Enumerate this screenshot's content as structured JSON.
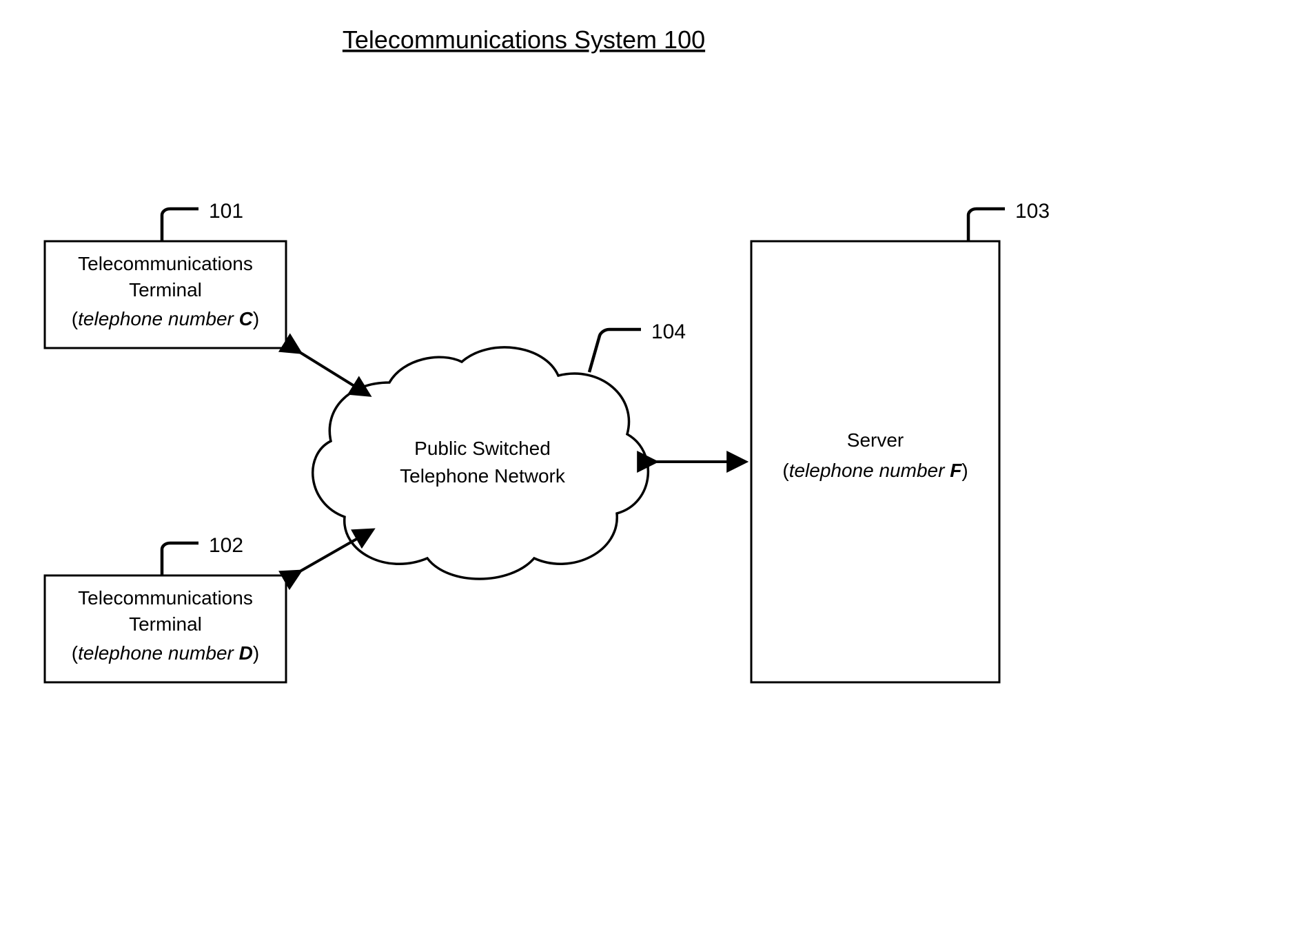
{
  "title": "Telecommunications System 100",
  "terminal1": {
    "num": "101",
    "line1": "Telecommunications",
    "line2": "Terminal",
    "line3_pre": "(",
    "line3_txt": "telephone number ",
    "line3_bold": "C",
    "line3_post": ")"
  },
  "terminal2": {
    "num": "102",
    "line1": "Telecommunications",
    "line2": "Terminal",
    "line3_pre": "(",
    "line3_txt": "telephone number ",
    "line3_bold": "D",
    "line3_post": ")"
  },
  "server": {
    "num": "103",
    "line1": "Server",
    "line2_pre": "(",
    "line2_txt": "telephone number ",
    "line2_bold": "F",
    "line2_post": ")"
  },
  "network": {
    "num": "104",
    "line1": "Public Switched",
    "line2": "Telephone Network"
  }
}
